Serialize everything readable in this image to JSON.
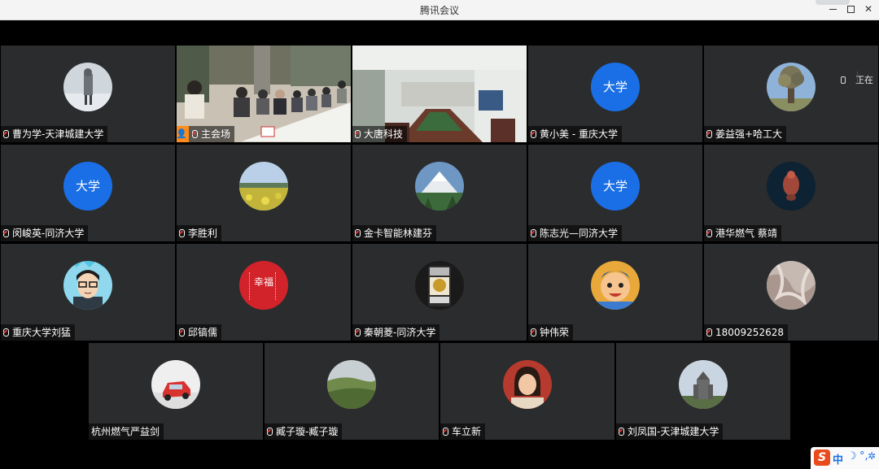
{
  "window": {
    "title": "腾讯会议"
  },
  "side_label": "正在",
  "participants": [
    {
      "name": "曹为学-天津城建大学",
      "avatar": "photo-winter-figure-icon"
    },
    {
      "name": "主会场",
      "avatar": "video-meeting-room",
      "host": true
    },
    {
      "name": "大唐科技",
      "avatar": "video-conference-hall"
    },
    {
      "name": "黄小美 - 重庆大学",
      "avatar_text": "大学"
    },
    {
      "name": "姜益强+哈工大",
      "avatar": "photo-tree-icon"
    },
    {
      "name": "闵峻英-同济大学",
      "avatar_text": "大学"
    },
    {
      "name": "李胜利",
      "avatar": "photo-flower-field-icon"
    },
    {
      "name": "金卡智能林建芬",
      "avatar": "photo-mountain-icon"
    },
    {
      "name": "陈志光—同济大学",
      "avatar_text": "大学"
    },
    {
      "name": "港华燃气 蔡靖",
      "avatar": "photo-fish-icon"
    },
    {
      "name": "重庆大学刘猛",
      "avatar": "cartoon-man-icon"
    },
    {
      "name": "邱镐儒",
      "avatar": "red-calligraphy-icon",
      "avatar_caption": "幸福"
    },
    {
      "name": "秦朝菱-同济大学",
      "avatar": "photo-can-icon"
    },
    {
      "name": "钟伟荣",
      "avatar": "cartoon-character-icon"
    },
    {
      "name": "18009252628",
      "avatar": "photo-fabric-icon"
    },
    {
      "name": "杭州燃气严益剑",
      "avatar": "red-car-icon"
    },
    {
      "name": "臧子璇-臧子璇",
      "avatar": "photo-landscape-icon"
    },
    {
      "name": "车立新",
      "avatar": "photo-woman-icon"
    },
    {
      "name": "刘凤国-天津城建大学",
      "avatar": "photo-castle-icon"
    }
  ],
  "ime": {
    "mode": "中"
  }
}
